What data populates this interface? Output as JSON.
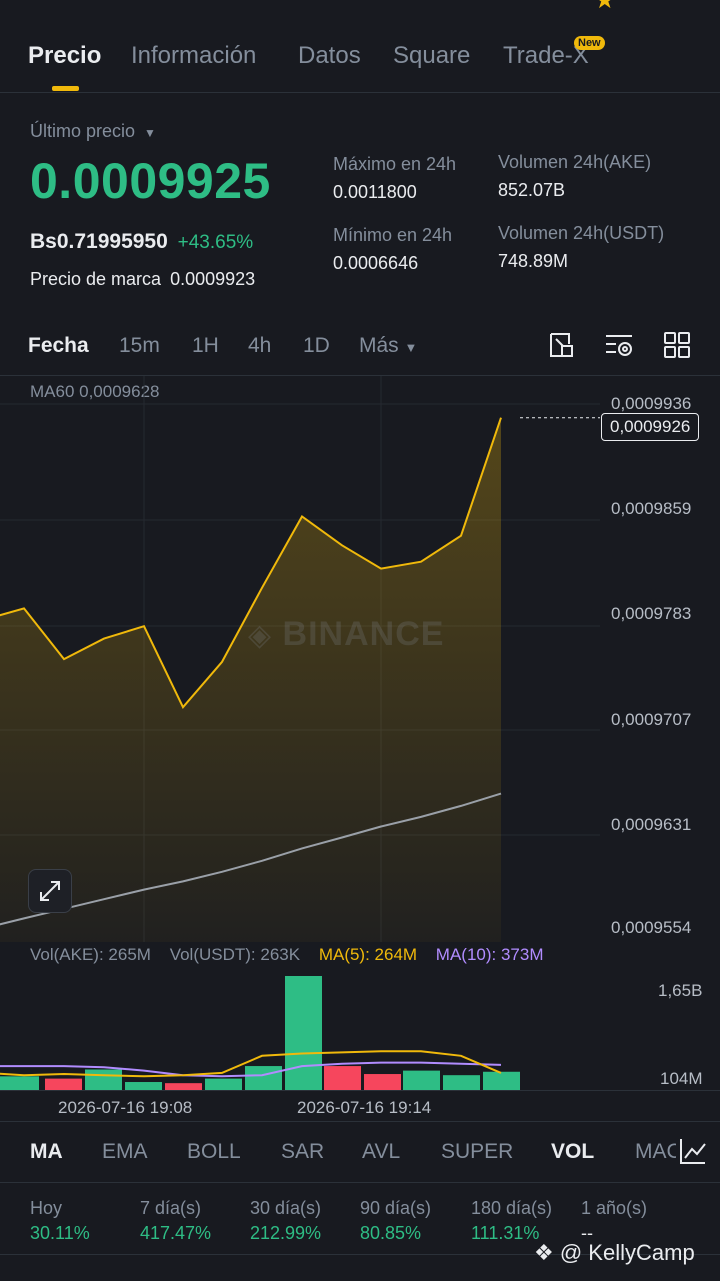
{
  "tabs": [
    {
      "label": "Precio",
      "active": true
    },
    {
      "label": "Información",
      "active": false
    },
    {
      "label": "Datos",
      "active": false
    },
    {
      "label": "Square",
      "active": false
    },
    {
      "label": "Trade-X",
      "active": false
    }
  ],
  "tab_badge": "New",
  "price": {
    "last_label": "Último precio",
    "last": "0.0009925",
    "fiat": "Bs0.71995950",
    "change": "+43.65%",
    "mark_label": "Precio de marca",
    "mark": "0.0009923"
  },
  "stats": {
    "high_label": "Máximo en 24h",
    "high": "0.0011800",
    "low_label": "Mínimo en 24h",
    "low": "0.0006646",
    "vol_base_label": "Volumen 24h(AKE)",
    "vol_base": "852.07B",
    "vol_quote_label": "Volumen 24h(USDT)",
    "vol_quote": "748.89M"
  },
  "intervals": [
    "Fecha",
    "15m",
    "1H",
    "4h",
    "1D",
    "Más"
  ],
  "chart": {
    "ma60_label": "MA60 0,0009628",
    "current_tag": "0,0009926",
    "watermark": "BINANCE",
    "vol_legend": {
      "base": "Vol(AKE): 265M",
      "quote": "Vol(USDT): 263K",
      "ma5": "MA(5): 264M",
      "ma10": "MA(10): 373M"
    },
    "vol_axis": [
      "1,65B",
      "104M"
    ],
    "time_labels": [
      "2026-07-16 19:08",
      "2026-07-16 19:14"
    ]
  },
  "chart_data": {
    "type": "line",
    "ylim": [
      0.0009554,
      0.0009936
    ],
    "yticks": [
      "0,0009936",
      "0,0009859",
      "0,0009783",
      "0,0009707",
      "0,0009631",
      "0,0009554"
    ],
    "price_series": [
      0.0009779,
      0.0009787,
      0.000975,
      0.0009765,
      0.0009774,
      0.0009715,
      0.0009748,
      0.0009802,
      0.0009854,
      0.0009833,
      0.0009816,
      0.0009821,
      0.000984,
      0.0009926
    ],
    "ma60_series": [
      0.0009554,
      0.0009561,
      0.0009568,
      0.0009575,
      0.0009582,
      0.0009588,
      0.0009595,
      0.0009603,
      0.0009612,
      0.000962,
      0.0009628,
      0.0009635,
      0.0009643,
      0.0009652
    ],
    "volume_bars": [
      {
        "v": 0.12,
        "up": true
      },
      {
        "v": 0.1,
        "up": false
      },
      {
        "v": 0.18,
        "up": true
      },
      {
        "v": 0.07,
        "up": true
      },
      {
        "v": 0.06,
        "up": false
      },
      {
        "v": 0.1,
        "up": true
      },
      {
        "v": 0.21,
        "up": true
      },
      {
        "v": 1.0,
        "up": true
      },
      {
        "v": 0.21,
        "up": false
      },
      {
        "v": 0.14,
        "up": false
      },
      {
        "v": 0.17,
        "up": true
      },
      {
        "v": 0.13,
        "up": true
      },
      {
        "v": 0.16,
        "up": true
      }
    ],
    "ma5_vol": [
      0.15,
      0.13,
      0.14,
      0.13,
      0.12,
      0.13,
      0.15,
      0.3,
      0.32,
      0.33,
      0.34,
      0.34,
      0.3,
      0.15
    ],
    "ma10_vol": [
      0.21,
      0.21,
      0.21,
      0.2,
      0.17,
      0.13,
      0.12,
      0.13,
      0.21,
      0.23,
      0.24,
      0.24,
      0.23,
      0.22
    ]
  },
  "indicators": [
    "MA",
    "EMA",
    "BOLL",
    "SAR",
    "AVL",
    "SUPER",
    "VOL",
    "MACD"
  ],
  "performance": [
    {
      "label": "Hoy",
      "value": "30.11%"
    },
    {
      "label": "7 día(s)",
      "value": "417.47%"
    },
    {
      "label": "30 día(s)",
      "value": "212.99%"
    },
    {
      "label": "90 día(s)",
      "value": "80.85%"
    },
    {
      "label": "180 día(s)",
      "value": "111.31%"
    },
    {
      "label": "1 año(s)",
      "value": "--"
    }
  ],
  "watermark_user": "@ KellyCamp",
  "colors": {
    "bg": "#181A20",
    "up": "#2EBD85",
    "down": "#F6465D",
    "accent": "#F0B90B",
    "ma10": "#B18CFF"
  }
}
